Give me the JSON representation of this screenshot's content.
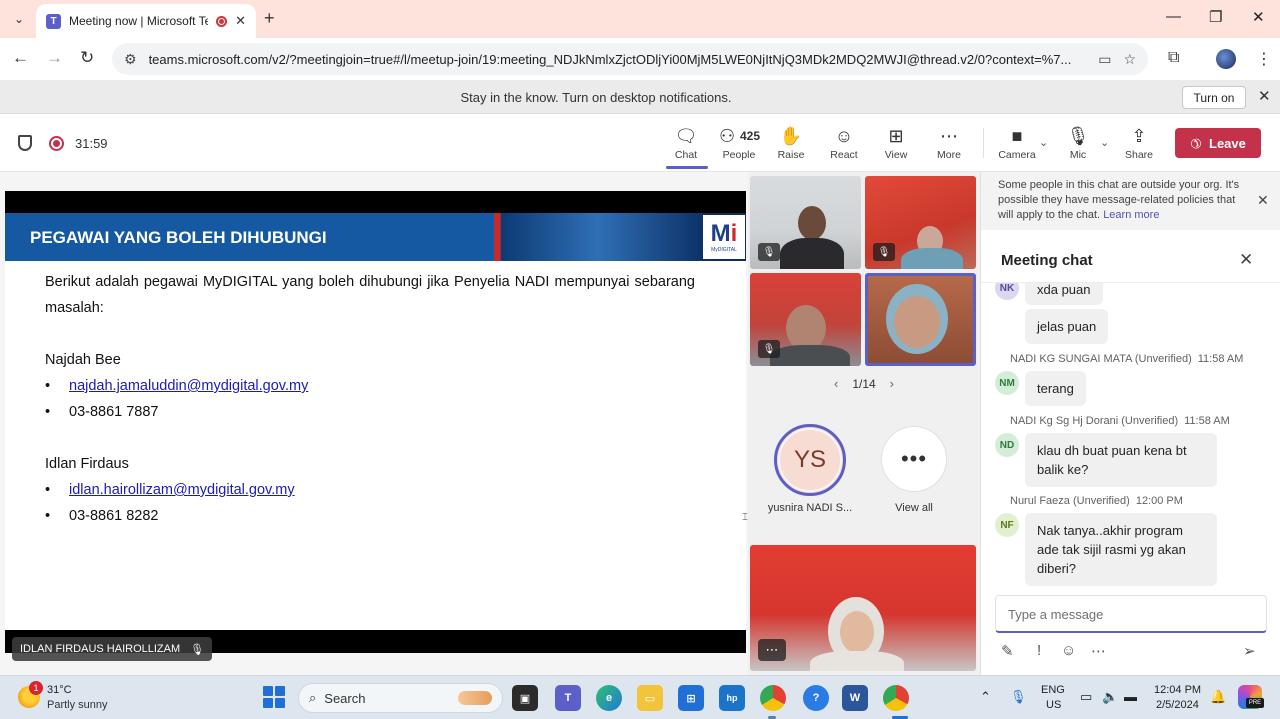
{
  "browser": {
    "tab_title": "Meeting now | Microsoft Teams",
    "tab_favicon": "teams-icon",
    "url": "teams.microsoft.com/v2/?meetingjoin=true#/l/meetup-join/19:meeting_NDJkNmlxZjctODljYi00MjM5LWE0NjItNjQ3MDk2MDQ2MWJI@thread.v2/0?context=%7..."
  },
  "notification": {
    "text": "Stay in the know. Turn on desktop notifications.",
    "button": "Turn on"
  },
  "meeting": {
    "timer": "31:59",
    "people_count": "425",
    "toolbar": {
      "chat": "Chat",
      "people": "People",
      "raise": "Raise",
      "react": "React",
      "view": "View",
      "more": "More",
      "camera": "Camera",
      "mic": "Mic",
      "share": "Share",
      "leave": "Leave"
    },
    "accent_color": "#5b5fc7",
    "leave_color": "#c4314b"
  },
  "slide": {
    "title": "PEGAWAI YANG BOLEH DIHUBUNGI",
    "logo_text": "MyDIGITAL",
    "intro": "Berikut adalah pegawai MyDIGITAL yang boleh dihubungi jika Penyelia NADI mempunyai sebarang masalah:",
    "contacts": [
      {
        "name": "Najdah Bee",
        "email": "najdah.jamaluddin@mydigital.gov.my",
        "phone": "03-8861 7887"
      },
      {
        "name": "Idlan Firdaus",
        "email": "idlan.hairollizam@mydigital.gov.my",
        "phone": "03-8861 8282"
      }
    ],
    "presenter": "IDLAN FIRDAUS HAIROLLIZAM"
  },
  "gallery": {
    "page": "1/14",
    "avatar_initials": "YS",
    "avatar_name": "yusnira NADI S...",
    "view_all": "View all"
  },
  "chat": {
    "notice": "Some people in this chat are outside your org. It's possible they have message-related policies that will apply to the chat.",
    "notice_link": "Learn more",
    "title": "Meeting chat",
    "messages": [
      {
        "initials": "NK",
        "sender": "",
        "time": "",
        "text": "xda puan"
      },
      {
        "initials": "",
        "sender": "",
        "time": "",
        "text": "jelas puan"
      },
      {
        "initials": "NM",
        "sender": "NADI KG SUNGAI MATA (Unverified)",
        "time": "11:58 AM",
        "text": "terang"
      },
      {
        "initials": "ND",
        "sender": "NADI Kg Sg Hj Dorani (Unverified)",
        "time": "11:58 AM",
        "text": "klau dh buat puan kena bt balik ke?"
      },
      {
        "initials": "NF",
        "sender": "Nurul Faeza (Unverified)",
        "time": "12:00 PM",
        "text": "Nak tanya..akhir program ade tak sijil rasmi yg akan diberi?"
      }
    ],
    "compose_placeholder": "Type a message"
  },
  "taskbar": {
    "weather_badge": "1",
    "temperature": "31°C",
    "weather": "Partly sunny",
    "search": "Search",
    "lang_line1": "ENG",
    "lang_line2": "US",
    "time": "12:04 PM",
    "date": "2/5/2024",
    "copilot_badge": "PRE"
  }
}
